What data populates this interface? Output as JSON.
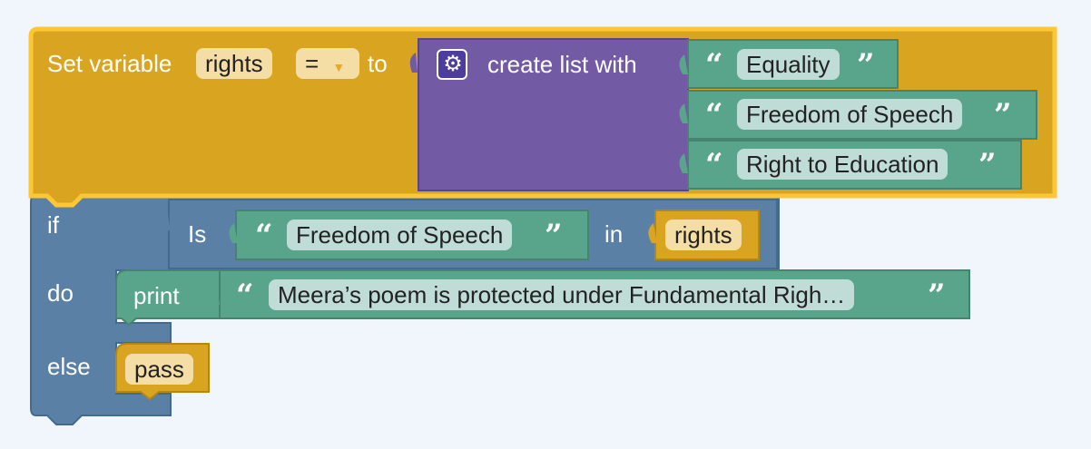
{
  "set_block": {
    "label": "Set variable",
    "variable": "rights",
    "operator": "=",
    "to_label": "to"
  },
  "list_block": {
    "label": "create list with",
    "items": [
      "Equality",
      "Freedom of Speech",
      "Right to Education"
    ]
  },
  "if_block": {
    "if_label": "if",
    "do_label": "do",
    "else_label": "else",
    "condition": {
      "is_label": "Is",
      "value": "Freedom of Speech",
      "in_label": "in",
      "variable": "rights"
    }
  },
  "print_block": {
    "label": "print",
    "text": "Meera’s poem is protected under Fundamental Righ…"
  },
  "pass_block": {
    "label": "pass"
  },
  "quote_open": "“",
  "quote_close": "”",
  "colors": {
    "variable_block": "#d9a520",
    "selection_outline": "#fcc733",
    "list_block": "#735aa5",
    "text_block": "#59a58c",
    "control_block": "#5b80a5"
  }
}
